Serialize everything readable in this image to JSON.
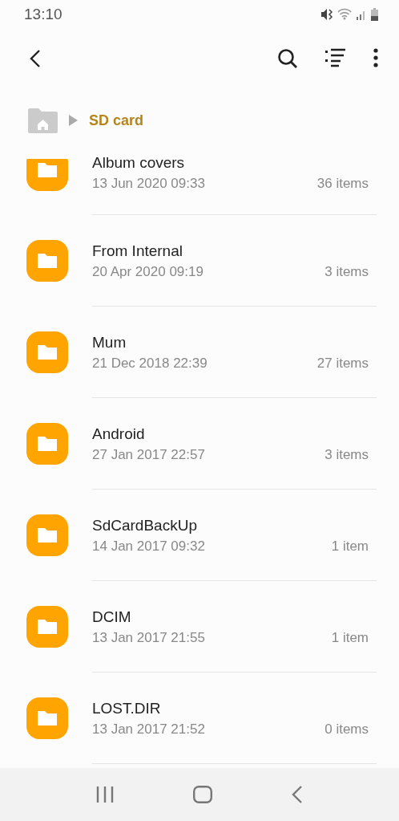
{
  "status_bar": {
    "time": "13:10"
  },
  "breadcrumb": {
    "current": "SD card"
  },
  "folders": [
    {
      "name": "Album covers",
      "date": "13 Jun 2020 09:33",
      "count": "36 items"
    },
    {
      "name": "From Internal",
      "date": "20 Apr 2020 09:19",
      "count": "3 items"
    },
    {
      "name": "Mum",
      "date": "21 Dec 2018 22:39",
      "count": "27 items"
    },
    {
      "name": "Android",
      "date": "27 Jan 2017 22:57",
      "count": "3 items"
    },
    {
      "name": "SdCardBackUp",
      "date": "14 Jan 2017 09:32",
      "count": "1 item"
    },
    {
      "name": "DCIM",
      "date": "13 Jan 2017 21:55",
      "count": "1 item"
    },
    {
      "name": "LOST.DIR",
      "date": "13 Jan 2017 21:52",
      "count": "0 items"
    }
  ]
}
